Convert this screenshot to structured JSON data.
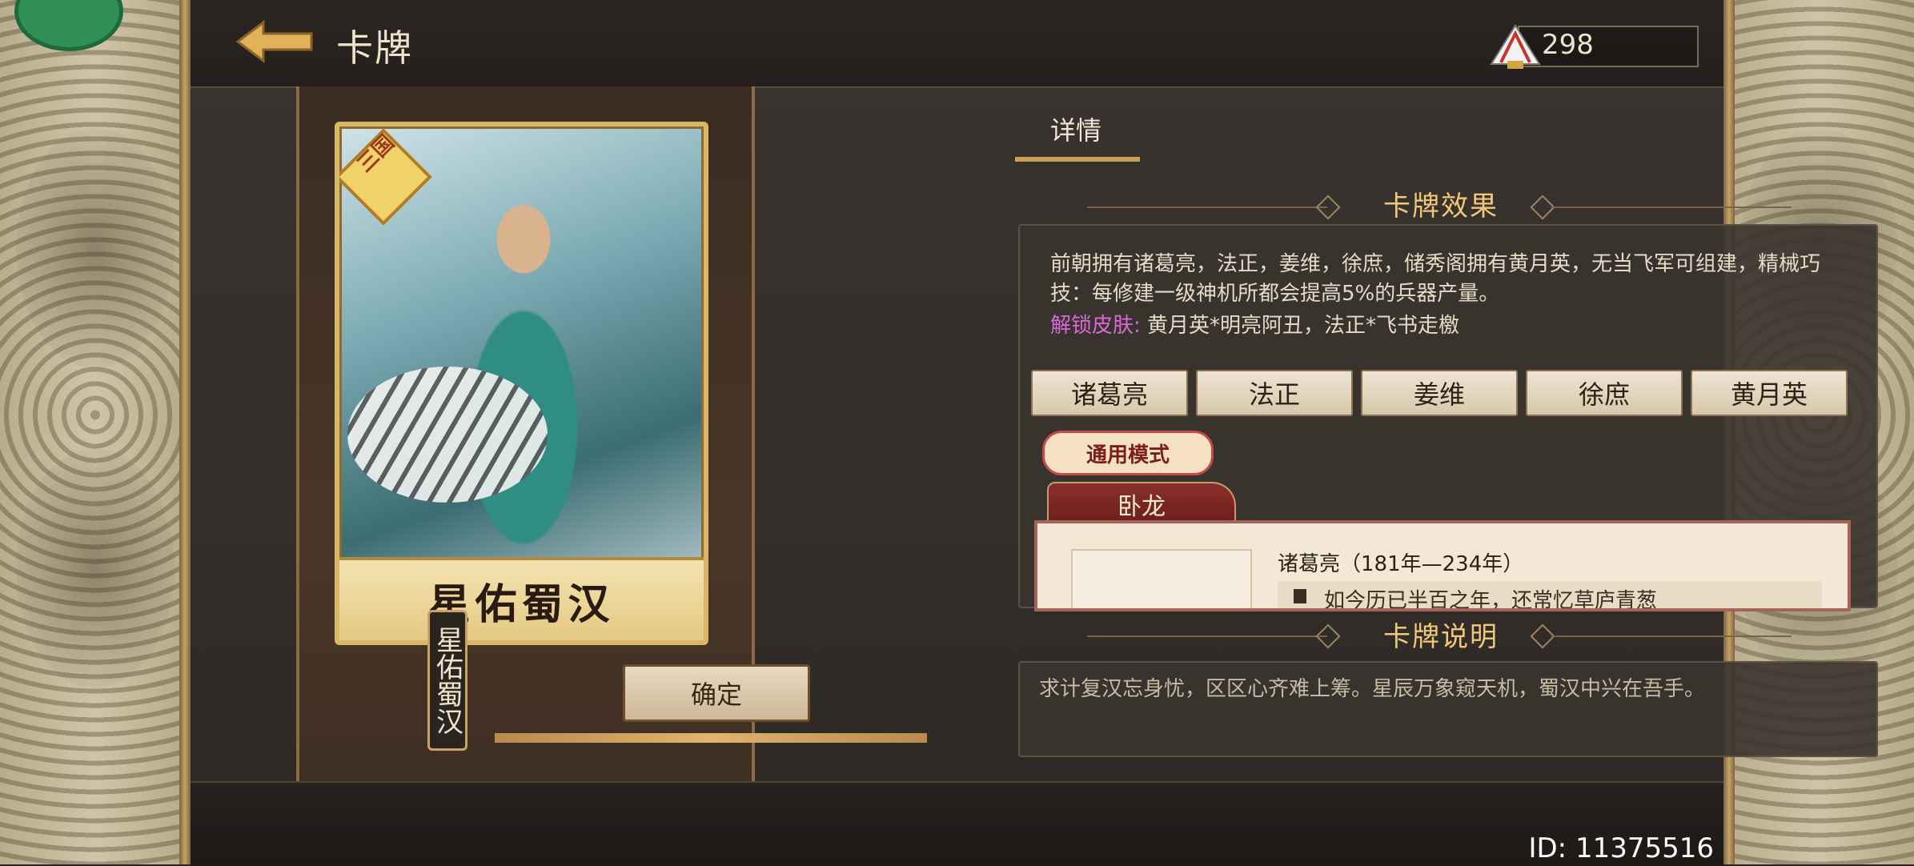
{
  "header": {
    "title": "卡牌",
    "currency_value": "298"
  },
  "card": {
    "name": "星佑蜀汉",
    "badge": "三国",
    "vertical_label": "星佑蜀汉",
    "confirm_label": "确定"
  },
  "details": {
    "tab_label": "详情",
    "effect_section_title": "卡牌效果",
    "effect_text": "前朝拥有诸葛亮，法正，姜维，徐庶，储秀阁拥有黄月英，无当飞军可组建，精械巧技：每修建一级神机所都会提高5%的兵器产量。",
    "unlock_skin_label": "解锁皮肤:",
    "unlock_skin_value": "黄月英*明亮阿丑，法正*飞书走檄",
    "heroes": [
      "诸葛亮",
      "法正",
      "姜维",
      "徐庶",
      "黄月英"
    ],
    "mode_tag": "通用模式",
    "sub_tab": "卧龙",
    "bio_title": "诸葛亮（181年—234年）",
    "bio_voice_text": "如今历已半百之年，还常忆草庐青葱",
    "description_section_title": "卡牌说明",
    "description_text": "求计复汉忘身忧，区区心齐难上筹。星辰万象窥天机，蜀汉中兴在吾手。"
  },
  "footer": {
    "user_id": "ID: 11375516"
  },
  "icons": {
    "back": "back-arrow-icon",
    "currency": "feather-fan-icon",
    "speaker": "speaker-icon"
  }
}
